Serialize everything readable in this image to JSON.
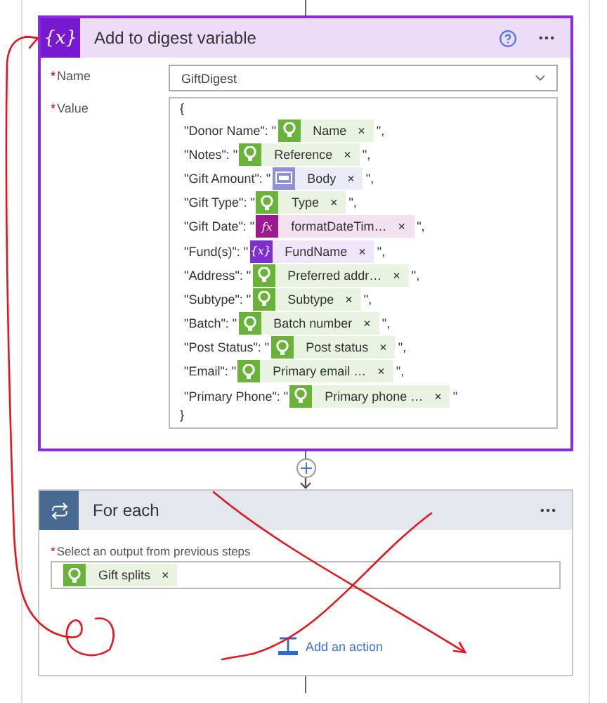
{
  "digest_step": {
    "icon_glyph": "{x}",
    "title": "Add to digest variable",
    "name_field": {
      "required_mark": "*",
      "label": "Name",
      "value": "GiftDigest"
    },
    "value_field": {
      "required_mark": "*",
      "label": "Value",
      "open_brace": "{",
      "close_brace": "}",
      "rows": [
        {
          "prefix": "\"Donor Name\": \"",
          "token": {
            "kind": "connector",
            "label": "Name",
            "remove": "×"
          },
          "suffix": "\","
        },
        {
          "prefix": "\"Notes\": \"",
          "token": {
            "kind": "connector",
            "label": "Reference",
            "remove": "×"
          },
          "suffix": "\","
        },
        {
          "prefix": "\"Gift Amount\": \"",
          "token": {
            "kind": "body",
            "label": "Body",
            "remove": "×"
          },
          "suffix": "\","
        },
        {
          "prefix": "\"Gift Type\": \"",
          "token": {
            "kind": "connector",
            "label": "Type",
            "remove": "×"
          },
          "suffix": "\","
        },
        {
          "prefix": "\"Gift Date\": \"",
          "token": {
            "kind": "expression",
            "glyph": "fx",
            "label": "formatDateTim…",
            "remove": "×"
          },
          "suffix": "\","
        },
        {
          "prefix": "\"Fund(s)\": \"",
          "token": {
            "kind": "variable",
            "glyph": "{x}",
            "label": "FundName",
            "remove": "×"
          },
          "suffix": "\","
        },
        {
          "prefix": "\"Address\": \"",
          "token": {
            "kind": "connector",
            "label": "Preferred addr…",
            "remove": "×"
          },
          "suffix": "\","
        },
        {
          "prefix": "\"Subtype\": \"",
          "token": {
            "kind": "connector",
            "label": "Subtype",
            "remove": "×"
          },
          "suffix": "\","
        },
        {
          "prefix": "\"Batch\": \"",
          "token": {
            "kind": "connector",
            "label": "Batch number",
            "remove": "×"
          },
          "suffix": "\","
        },
        {
          "prefix": "\"Post Status\": \"",
          "token": {
            "kind": "connector",
            "label": "Post status",
            "remove": "×"
          },
          "suffix": "\","
        },
        {
          "prefix": "\"Email\": \"",
          "token": {
            "kind": "connector",
            "label": "Primary email …",
            "remove": "×"
          },
          "suffix": "\","
        },
        {
          "prefix": "\"Primary Phone\": \"",
          "token": {
            "kind": "connector",
            "label": "Primary phone …",
            "remove": "×"
          },
          "suffix": "\""
        }
      ]
    }
  },
  "for_each_step": {
    "title": "For each",
    "output_field": {
      "required_mark": "*",
      "label": "Select an output from previous steps",
      "tokens": [
        {
          "kind": "connector",
          "label": "Gift splits",
          "remove": "×"
        }
      ]
    },
    "add_action": "Add an action"
  }
}
